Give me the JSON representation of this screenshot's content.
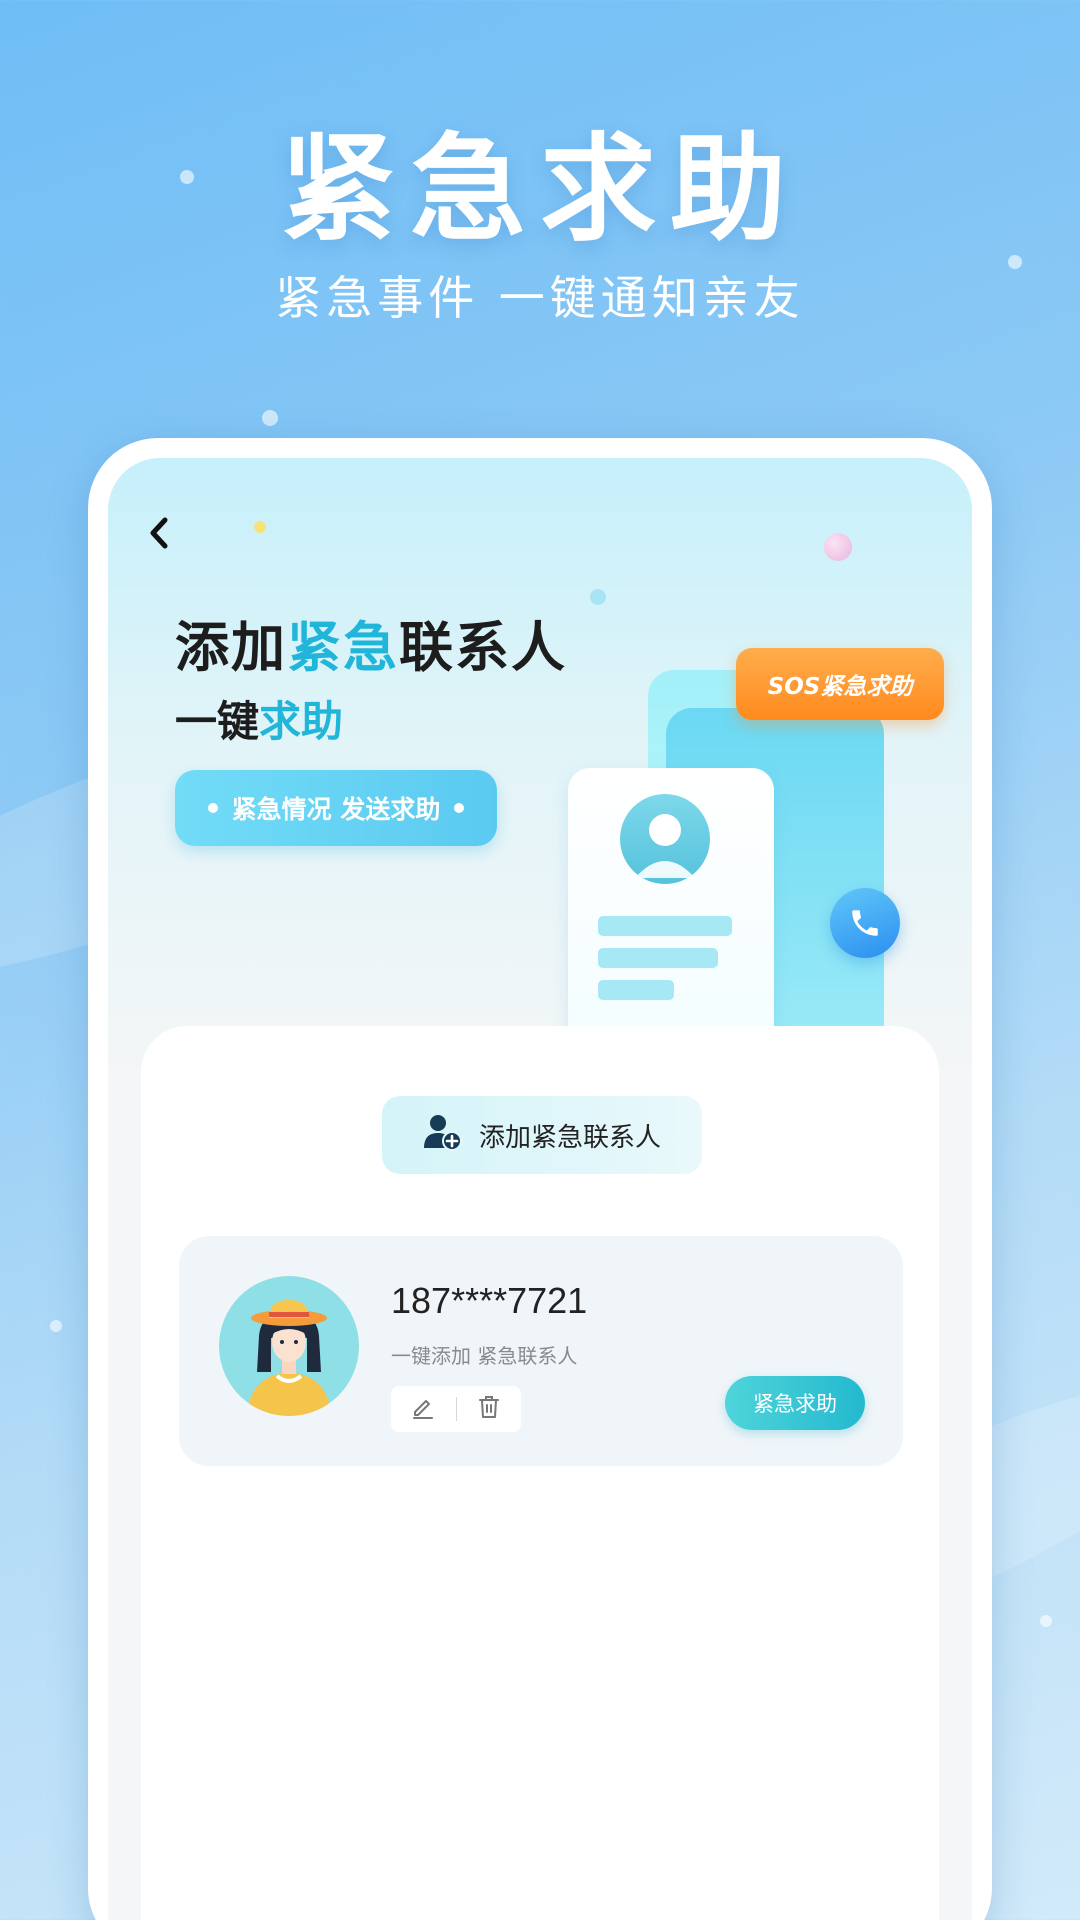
{
  "hero": {
    "title": "紧急求助",
    "subtitle": "紧急事件 一键通知亲友"
  },
  "banner": {
    "title_part1": "添加",
    "title_highlight": "紧急",
    "title_part2": "联系人",
    "subtitle_part1": "一键",
    "subtitle_highlight": "求助",
    "pill_text": "紧急情况 发送求助",
    "sos_badge": "SOS紧急求助"
  },
  "panel": {
    "add_button_label": "添加紧急联系人"
  },
  "contact": {
    "phone": "187****7721",
    "description": "一键添加 紧急联系人",
    "sos_button_label": "紧急求助"
  },
  "colors": {
    "accent": "#21b6d9",
    "sos_orange": "#ff8a1e",
    "teal_button": "#24b9cf"
  },
  "icons": [
    "back-arrow-icon",
    "add-user-icon",
    "edit-icon",
    "delete-icon",
    "phone-call-icon",
    "contact-avatar-icon"
  ]
}
